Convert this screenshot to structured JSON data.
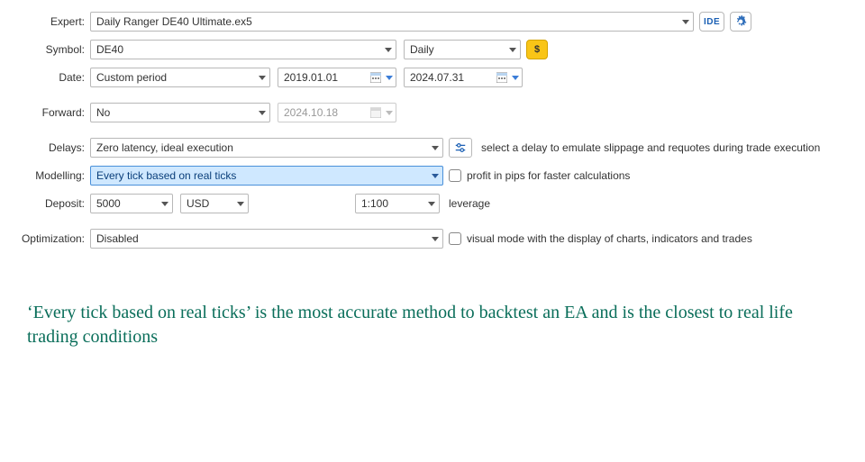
{
  "labels": {
    "expert": "Expert:",
    "symbol": "Symbol:",
    "date": "Date:",
    "forward": "Forward:",
    "delays": "Delays:",
    "modelling": "Modelling:",
    "deposit": "Deposit:",
    "optimization": "Optimization:"
  },
  "expert": {
    "value": "Daily Ranger DE40 Ultimate.ex5",
    "ide_label": "IDE"
  },
  "symbol": {
    "value": "DE40",
    "timeframe": "Daily",
    "dollar": "$"
  },
  "date": {
    "period": "Custom period",
    "from": "2019.01.01",
    "to": "2024.07.31"
  },
  "forward": {
    "value": "No",
    "date": "2024.10.18"
  },
  "delays": {
    "value": "Zero latency, ideal execution",
    "desc": "select a delay to emulate slippage and requotes during trade execution"
  },
  "modelling": {
    "value": "Every tick based on real ticks",
    "pips_label": "profit in pips for faster calculations"
  },
  "deposit": {
    "amount": "5000",
    "currency": "USD",
    "leverage": "1:100",
    "leverage_label": "leverage"
  },
  "optimization": {
    "value": "Disabled",
    "visual_label": "visual mode with the display of charts, indicators and trades"
  },
  "caption": "‘Every tick based on real ticks’ is the most accurate method to backtest an EA and is the closest to real life trading conditions"
}
